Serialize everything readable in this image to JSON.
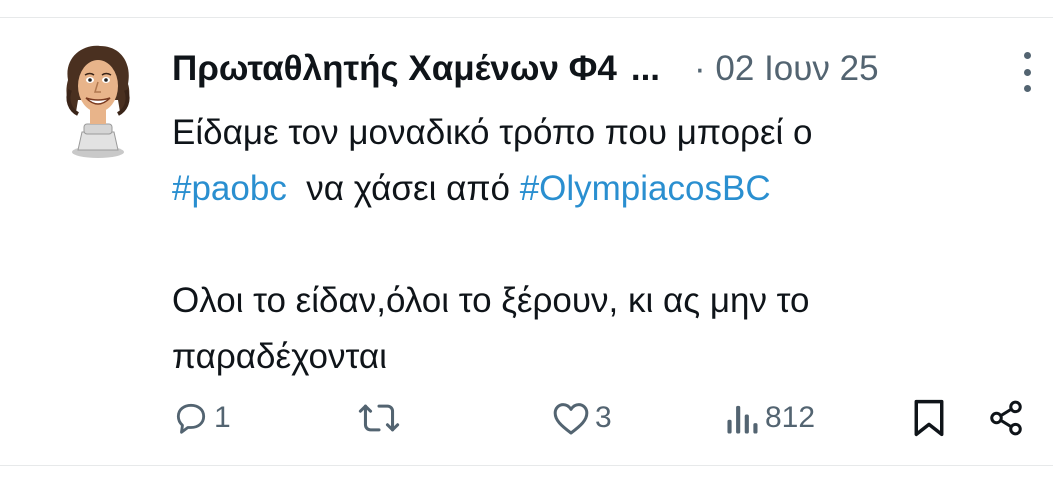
{
  "tweet": {
    "author_name": "Πρωταθλητής Χαμένων Φ4",
    "ellipsis": "...",
    "date": "· 02 Ιουν 25",
    "text": {
      "line1": "Είδαμε τον μοναδικό τρόπο που μπορεί ο",
      "hashtag1": "#paobc",
      "middle": "  να χάσει από ",
      "hashtag2": "#OlympiacosBC",
      "line3": "Ολοι το είδαν,όλοι το ξέρουν, κι ας μην το",
      "line4": "παραδέχονται"
    },
    "actions": {
      "replies": "1",
      "reposts": "",
      "likes": "3",
      "views": "812"
    }
  },
  "icons": {
    "reply": "reply-icon",
    "repost": "repost-icon",
    "like": "heart-icon",
    "views": "views-icon",
    "bookmark": "bookmark-icon",
    "share": "share-icon",
    "more": "more-icon"
  },
  "colors": {
    "hashtag": "#2a8fd0",
    "secondary": "#536471",
    "text": "#0f1419"
  }
}
